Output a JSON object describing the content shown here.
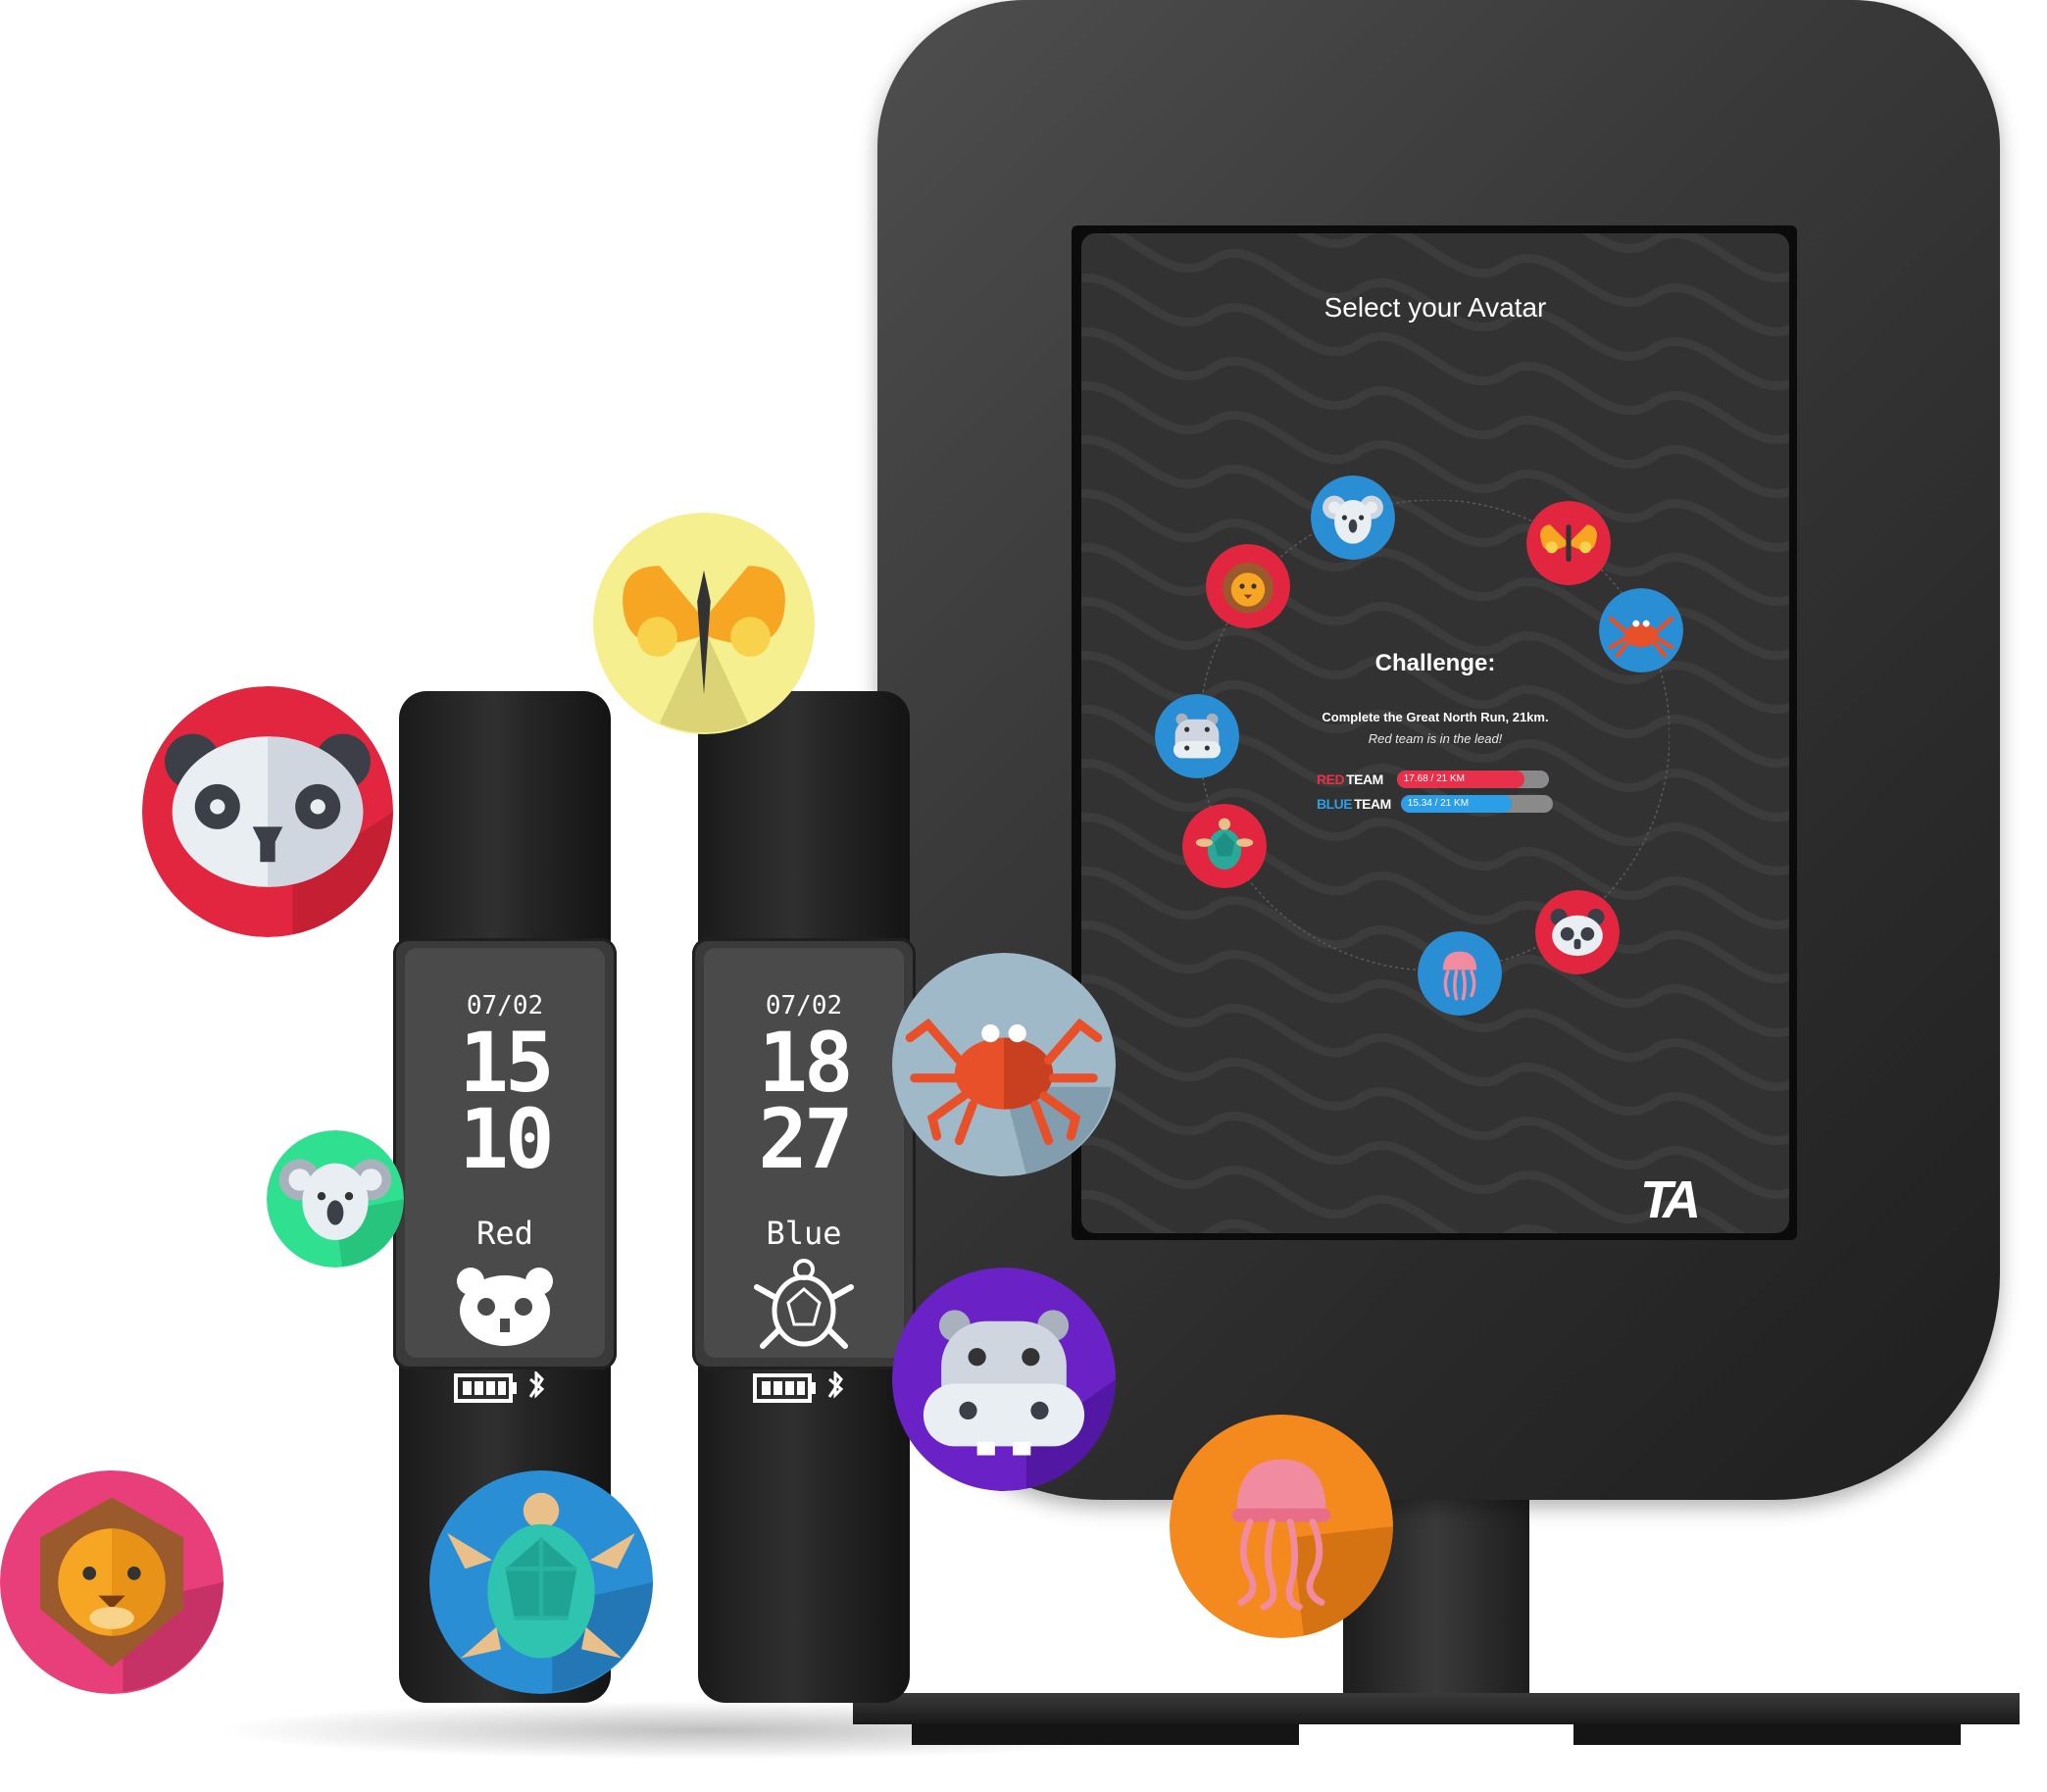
{
  "kiosk": {
    "screen_title": "Select your Avatar",
    "challenge": {
      "title": "Challenge:",
      "description": "Complete the Great North Run, 21km.",
      "lead_note": "Red team is in the lead!"
    },
    "teams": [
      {
        "label_a": "RED",
        "label_b": "TEAM",
        "progress_text": "17.68 / 21 KM",
        "value": 17.68,
        "total": 21,
        "color": "#e8304a"
      },
      {
        "label_a": "BLUE",
        "label_b": "TEAM",
        "progress_text": "15.34 / 21 KM",
        "value": 15.34,
        "total": 21,
        "color": "#2a9ee6"
      }
    ],
    "logo": "TA",
    "screen_avatars": [
      "koala-icon",
      "butterfly-icon",
      "lion-icon",
      "crab-icon",
      "hippo-icon",
      "turtle-icon",
      "panda-icon",
      "jellyfish-icon"
    ]
  },
  "bands": [
    {
      "date": "07/02",
      "hour": "15",
      "minute": "10",
      "team": "Red",
      "avatar": "panda-icon"
    },
    {
      "date": "07/02",
      "hour": "18",
      "minute": "27",
      "team": "Blue",
      "avatar": "turtle-icon"
    }
  ],
  "floating_avatars": [
    "butterfly-icon",
    "panda-icon",
    "koala-icon",
    "crab-icon",
    "hippo-icon",
    "jellyfish-icon",
    "lion-icon",
    "turtle-icon"
  ],
  "colors": {
    "red": "#e8304a",
    "blue": "#2a9ee6",
    "kiosk": "#3a3a3a",
    "screen": "#323232"
  }
}
